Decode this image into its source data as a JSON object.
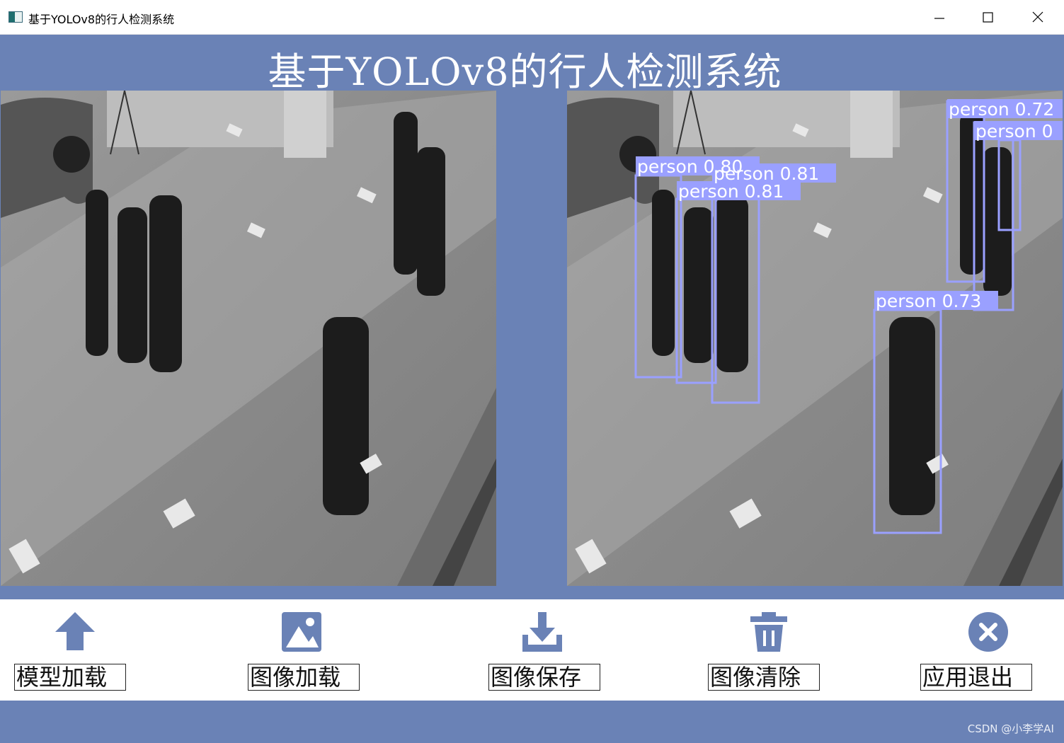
{
  "window": {
    "title": "基于YOLOv8的行人检测系统",
    "controls": [
      "minimize-icon",
      "maximize-icon",
      "close-icon"
    ]
  },
  "app": {
    "title": "基于YOLOv8的行人检测系统",
    "accent_color": "#6a82b6",
    "box_color": "#9aa0ff"
  },
  "panes": {
    "original": {
      "content": "grayscale mall corridor photo"
    },
    "result": {
      "detections": [
        {
          "label": "person 0.80"
        },
        {
          "label": "person 0.81"
        },
        {
          "label": "person 0.81"
        },
        {
          "label": "person 0.72"
        },
        {
          "label": "person 0"
        },
        {
          "label": "person 0.73"
        }
      ]
    }
  },
  "toolbar": {
    "buttons": [
      {
        "label": "模型加载",
        "icon": "upload-arrow-icon"
      },
      {
        "label": "图像加载",
        "icon": "image-icon"
      },
      {
        "label": "图像保存",
        "icon": "download-icon"
      },
      {
        "label": "图像清除",
        "icon": "trash-icon"
      },
      {
        "label": "应用退出",
        "icon": "close-circle-icon"
      }
    ]
  },
  "watermark": "CSDN @小李学AI"
}
